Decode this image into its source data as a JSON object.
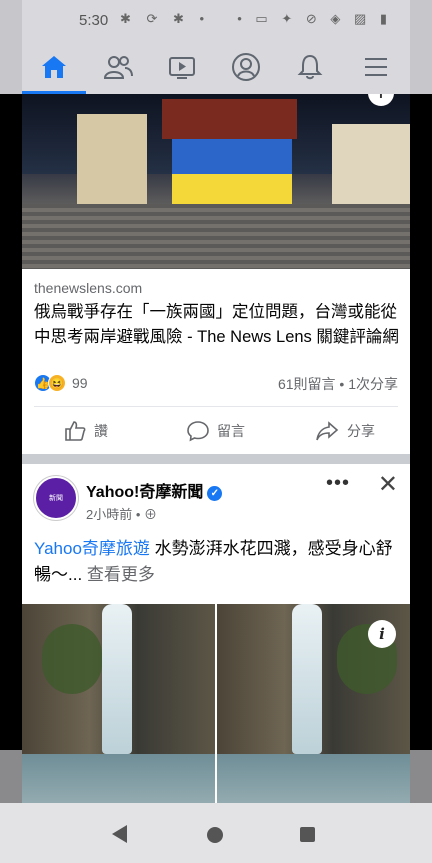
{
  "status_bar": {
    "time": "5:30",
    "left_icons": [
      "android-icon",
      "sync-icon",
      "android-icon",
      "dot"
    ],
    "right_icons": [
      "dot",
      "cast-icon",
      "bluetooth-icon",
      "mute-icon",
      "wifi-icon",
      "no-sim-icon",
      "battery-icon"
    ]
  },
  "nav": {
    "tabs": [
      {
        "name": "home-icon",
        "active": true
      },
      {
        "name": "friends-icon",
        "active": false
      },
      {
        "name": "watch-icon",
        "active": false
      },
      {
        "name": "profile-icon",
        "active": false
      },
      {
        "name": "notifications-icon",
        "active": false
      },
      {
        "name": "menu-icon",
        "active": false
      }
    ],
    "accent": "#1877f2"
  },
  "post1": {
    "link_domain": "thenewslens.com",
    "link_title": "俄烏戰爭存在「一族兩國」定位問題，台灣或能從中思考兩岸避戰風險 - The News Lens 關鍵評論網",
    "reaction_count": "99",
    "comments_shares": "61則留言 • 1次分享",
    "actions": {
      "like": "讚",
      "comment": "留言",
      "share": "分享"
    }
  },
  "post2": {
    "page_name": "Yahoo!奇摩新聞",
    "time": "2小時前 •",
    "avatar_text": "新聞",
    "text_tag": "Yahoo奇摩旅遊",
    "text_body": " 水勢澎湃水花四濺，感受身心舒暢～...",
    "see_more": " 查看更多"
  }
}
